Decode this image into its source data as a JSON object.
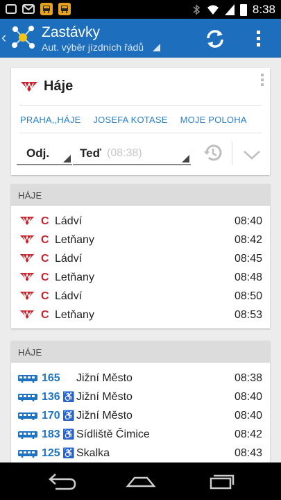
{
  "status_bar": {
    "time": "8:38",
    "icons": [
      "gallery-icon",
      "mail-icon",
      "bus-app-icon",
      "bus-app-icon",
      "bluetooth-icon",
      "wifi-icon",
      "signal-icon",
      "battery-icon"
    ]
  },
  "app_bar": {
    "title": "Zastávky",
    "subtitle": "Aut. výběr jízdních řádů",
    "color": "#1d6fbd"
  },
  "stop_card": {
    "stop_name": "Háje",
    "quick_links": [
      "PRAHA,,HÁJE",
      "JOSEFA KOTASE",
      "MOJE POLOHA"
    ],
    "departure_type": "Odj.",
    "time_mode": "Teď",
    "time_value": "(08:38)"
  },
  "metro_section": {
    "header": "HÁJE",
    "line_color": "#c8232c",
    "rows": [
      {
        "line": "C",
        "destination": "Ládví",
        "time": "08:40"
      },
      {
        "line": "C",
        "destination": "Letňany",
        "time": "08:42"
      },
      {
        "line": "C",
        "destination": "Ládví",
        "time": "08:45"
      },
      {
        "line": "C",
        "destination": "Letňany",
        "time": "08:48"
      },
      {
        "line": "C",
        "destination": "Ládví",
        "time": "08:50"
      },
      {
        "line": "C",
        "destination": "Letňany",
        "time": "08:53"
      }
    ]
  },
  "bus_section": {
    "header": "HÁJE",
    "line_color": "#1f74c2",
    "rows": [
      {
        "line": "165",
        "accessible": false,
        "destination": "Jižní Město",
        "time": "08:38"
      },
      {
        "line": "136",
        "accessible": true,
        "destination": "Jižní Město",
        "time": "08:40"
      },
      {
        "line": "170",
        "accessible": true,
        "destination": "Jižní Město",
        "time": "08:40"
      },
      {
        "line": "183",
        "accessible": true,
        "destination": "Sídliště Čimice",
        "time": "08:42"
      },
      {
        "line": "125",
        "accessible": true,
        "destination": "Skalka",
        "time": "08:43"
      }
    ]
  }
}
